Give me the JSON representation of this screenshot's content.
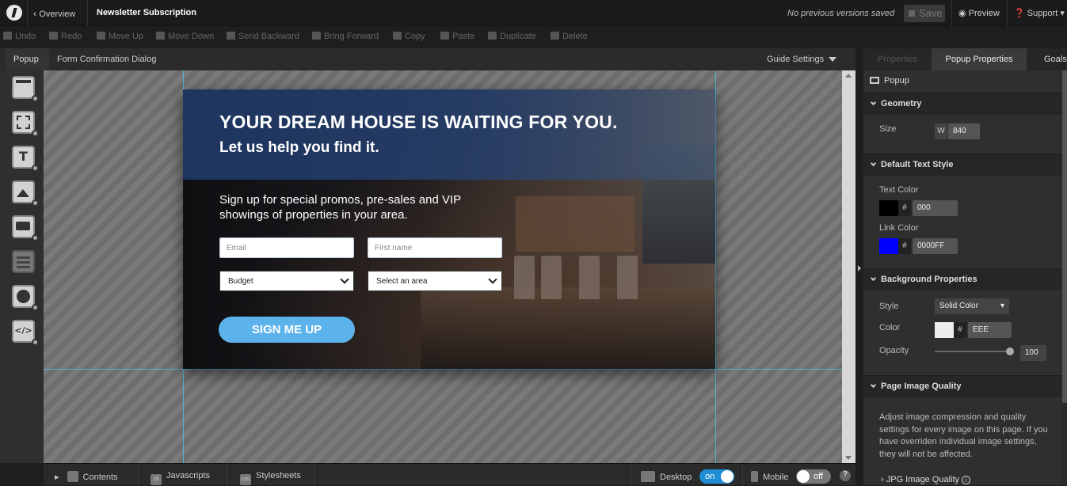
{
  "header": {
    "back_label": "Overview",
    "page_name": "Newsletter Subscription",
    "versions_text": "No previous versions saved",
    "save_label": "Save",
    "preview_label": "Preview",
    "support_label": "Support"
  },
  "toolbar": {
    "undo": "Undo",
    "redo": "Redo",
    "move_up": "Move Up",
    "move_down": "Move Down",
    "send_backward": "Send Backward",
    "bring_forward": "Bring Forward",
    "copy": "Copy",
    "paste": "Paste",
    "duplicate": "Duplicate",
    "delete": "Delete"
  },
  "tabs": {
    "popup": "Popup",
    "form_dialog": "Form Confirmation Dialog",
    "guide_settings": "Guide Settings"
  },
  "palette": {
    "items": [
      "section-icon",
      "box-icon",
      "text-icon",
      "image-icon",
      "button-icon",
      "form-icon",
      "video-icon",
      "code-icon"
    ],
    "text_glyph": "T",
    "code_glyph": "</>"
  },
  "popup_content": {
    "headline": "YOUR DREAM HOUSE IS WAITING FOR YOU.",
    "subhead": "Let us help you find it.",
    "promo": "Sign up for special promos, pre-sales and VIP showings of properties in your area.",
    "email_placeholder": "Email",
    "firstname_placeholder": "First name",
    "budget_select": "Budget",
    "area_select": "Select an area",
    "button_label": "SIGN ME UP"
  },
  "bottom_bar": {
    "contents": "Contents",
    "javascripts": "Javascripts",
    "stylesheets": "Stylesheets",
    "desktop": "Desktop",
    "desktop_toggle": "on",
    "mobile": "Mobile",
    "mobile_toggle": "off",
    "help": "?",
    "js_badge": "JS",
    "css_badge": "CSS"
  },
  "right_panel": {
    "tabs": [
      "Properties",
      "Popup Properties",
      "Goals"
    ],
    "active_tab": "Popup Properties",
    "popup_label": "Popup",
    "geometry_label": "Geometry",
    "size_label": "Size",
    "width_prefix": "W",
    "width_value": "840",
    "default_text_style": "Default Text Style",
    "text_color_label": "Text Color",
    "text_color_hash": "#",
    "text_color_value": "000",
    "text_color_hex": "#000000",
    "link_color_label": "Link Color",
    "link_color_hash": "#",
    "link_color_value": "0000FF",
    "link_color_hex": "#0000FF",
    "background_properties": "Background Properties",
    "style_label": "Style",
    "style_value": "Solid Color",
    "color_label": "Color",
    "color_hash": "#",
    "color_value": "EEE",
    "color_hex": "#EEEEEE",
    "opacity_label": "Opacity",
    "opacity_value": "100",
    "page_image_quality": "Page Image Quality",
    "quality_description": "Adjust image compression and quality settings for every image on this page. If you have overriden individual image settings, they will not be affected.",
    "jpg_quality_label": "JPG Image Quality",
    "info_glyph": "i"
  },
  "colors": {
    "accent_button": "#5cb3ec",
    "toggle_on": "#1e8fd5",
    "guide_line": "#4fb3d9"
  }
}
